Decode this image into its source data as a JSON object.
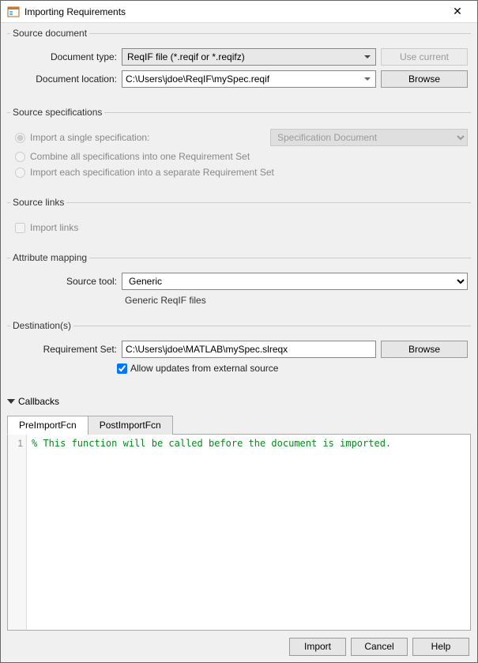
{
  "window": {
    "title": "Importing Requirements"
  },
  "sections": {
    "source_doc": {
      "legend": "Source document",
      "doc_type_label": "Document type:",
      "doc_type_value": "ReqIF file (*.reqif or *.reqifz)",
      "use_current": "Use current",
      "doc_loc_label": "Document location:",
      "doc_loc_value": "C:\\Users\\jdoe\\ReqIF\\mySpec.reqif",
      "browse": "Browse"
    },
    "source_spec": {
      "legend": "Source specifications",
      "opt1": "Import a single specification:",
      "spec_select": "Specification Document",
      "opt2": "Combine all specifications into one Requirement Set",
      "opt3": "Import each specification into a separate Requirement Set"
    },
    "source_links": {
      "legend": "Source links",
      "import_links": "Import links"
    },
    "attr_map": {
      "legend": "Attribute mapping",
      "tool_label": "Source tool:",
      "tool_value": "Generic",
      "tool_desc": "Generic ReqIF files"
    },
    "dest": {
      "legend": "Destination(s)",
      "set_label": "Requirement Set:",
      "set_value": "C:\\Users\\jdoe\\MATLAB\\mySpec.slreqx",
      "browse": "Browse",
      "allow_updates": "Allow updates from external source"
    },
    "callbacks": {
      "header": "Callbacks",
      "tab1": "PreImportFcn",
      "tab2": "PostImportFcn",
      "line_no": "1",
      "code": "% This function will be called before the document is imported."
    }
  },
  "footer": {
    "import": "Import",
    "cancel": "Cancel",
    "help": "Help"
  }
}
